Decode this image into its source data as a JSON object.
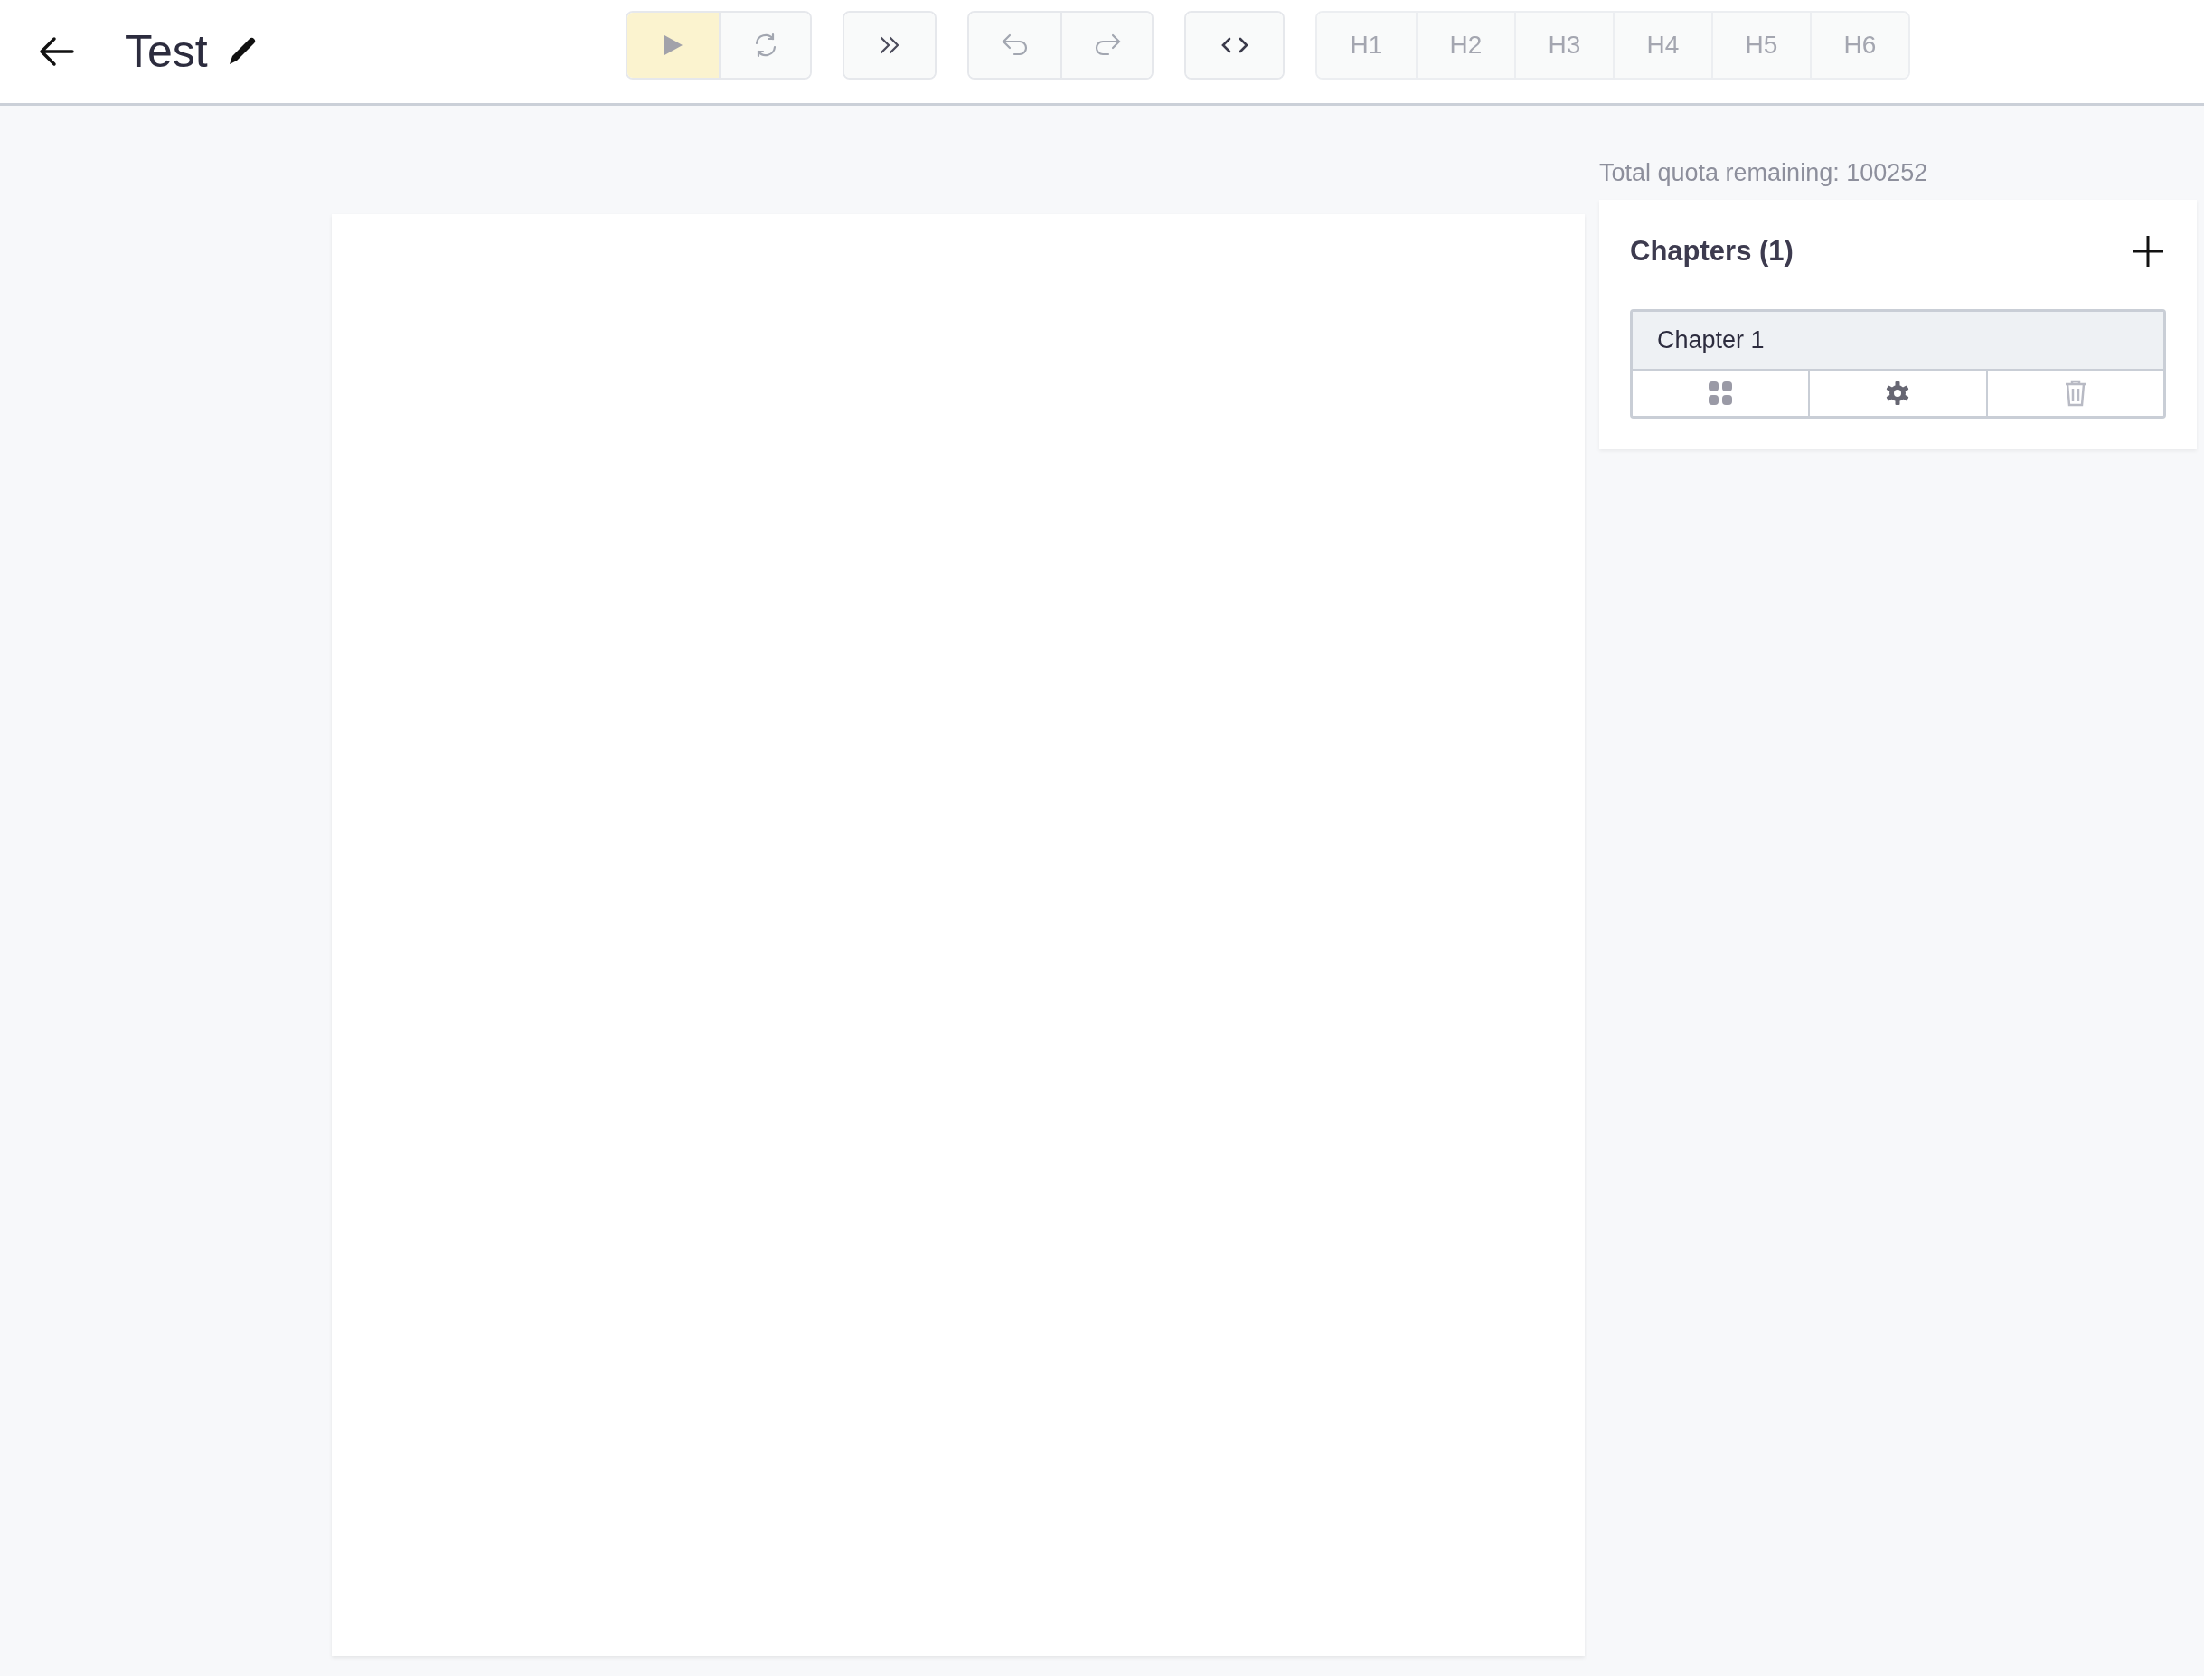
{
  "header": {
    "title": "Test"
  },
  "toolbar_groups": [
    {
      "buttons": [
        {
          "kind": "play",
          "highlighted": true
        },
        {
          "kind": "refresh",
          "highlighted": false
        }
      ]
    },
    {
      "buttons": [
        {
          "kind": "skip",
          "highlighted": false
        }
      ]
    },
    {
      "buttons": [
        {
          "kind": "undo",
          "highlighted": false
        },
        {
          "kind": "redo",
          "highlighted": false
        }
      ]
    },
    {
      "buttons": [
        {
          "kind": "code",
          "highlighted": false
        }
      ]
    }
  ],
  "headings": [
    {
      "label": "H1",
      "disabled": true
    },
    {
      "label": "H2",
      "disabled": true
    },
    {
      "label": "H3",
      "disabled": true
    },
    {
      "label": "H4",
      "disabled": true
    },
    {
      "label": "H5",
      "disabled": true
    },
    {
      "label": "H6",
      "disabled": true
    }
  ],
  "quota": "Total quota remaining: 100252",
  "chapters": {
    "title": "Chapters (1)",
    "items": [
      {
        "title": "Chapter 1"
      }
    ]
  }
}
